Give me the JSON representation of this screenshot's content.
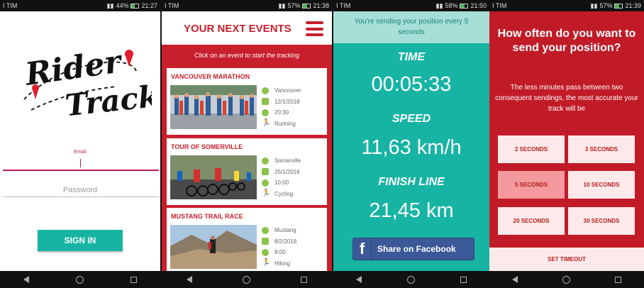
{
  "screens": [
    {
      "status": {
        "carrier": "I TIM",
        "battery": "44%",
        "time": "21:27",
        "battery_level": 0.44
      }
    },
    {
      "status": {
        "carrier": "I TIM",
        "battery": "57%",
        "time": "21:38",
        "battery_level": 0.57
      }
    },
    {
      "status": {
        "carrier": "I TIM",
        "battery": "58%",
        "time": "21:50",
        "battery_level": 0.58
      }
    },
    {
      "status": {
        "carrier": "I TIM",
        "battery": "57%",
        "time": "21:39",
        "battery_level": 0.57
      }
    }
  ],
  "login": {
    "logo_text_1": "Rider",
    "logo_text_2": "Track",
    "email_label": "Email",
    "password_placeholder": "Password",
    "sign_in_label": "SIGN IN"
  },
  "events": {
    "title": "YOUR NEXT EVENTS",
    "hint": "Click on an event to start the tracking",
    "items": [
      {
        "name": "VANCOUVER MARATHON",
        "location": "Vancouver",
        "date": "12/1/2018",
        "time": "20:30",
        "sport": "Running"
      },
      {
        "name": "TOUR OF SOMERVILLE",
        "location": "Somerville",
        "date": "25/1/2018",
        "time": "10:00",
        "sport": "Cycling"
      },
      {
        "name": "MUSTANG TRAIL RACE",
        "location": "Mustang",
        "date": "8/2/2018",
        "time": "9:00",
        "sport": "Hiking"
      }
    ]
  },
  "tracking": {
    "tip": "You're sending your position every 5 seconds",
    "time_label": "TIME",
    "time_value": "00:05:33",
    "speed_label": "SPEED",
    "speed_value": "11,63 km/h",
    "finish_label": "FINISH LINE",
    "finish_value": "21,45 km",
    "facebook_label": "Share on Facebook"
  },
  "interval": {
    "question": "How often do you want to send your position?",
    "subtitle": "The less minutes pass between two consequent sendings, the most accurate your track will be",
    "options": [
      "2 SECONDS",
      "3 SECONDS",
      "5 SECONDS",
      "10 SECONDS",
      "20 SECONDS",
      "30 SECONDS"
    ],
    "selected": "5 SECONDS",
    "set_label": "SET TIMEOUT"
  },
  "colors": {
    "teal": "#17b4a4",
    "red": "#c81f2d",
    "pink": "#c2185b",
    "facebook": "#3b5998"
  }
}
